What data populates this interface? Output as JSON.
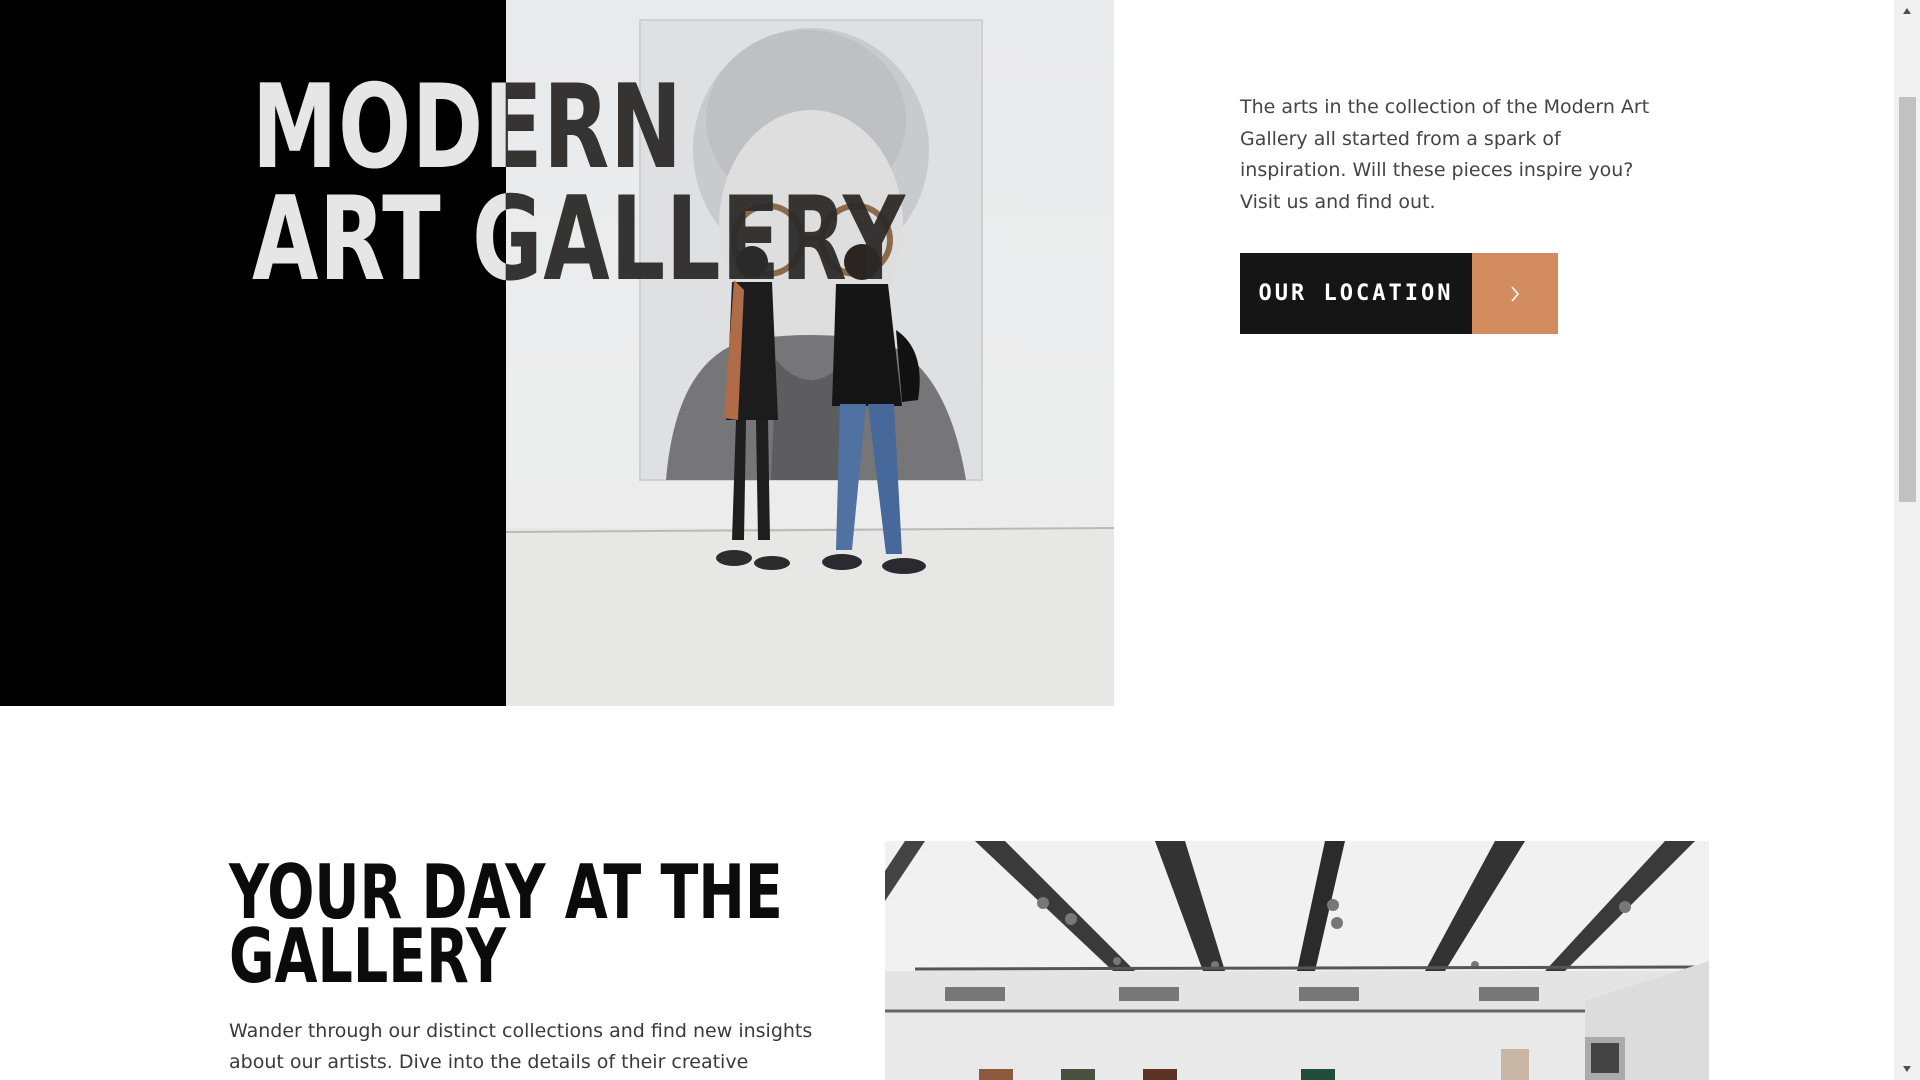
{
  "hero": {
    "title_line1": "MODERN",
    "title_line2": "ART GALLERY",
    "description": "The arts in the collection of the Modern Art Gallery all started from a spark of inspiration. Will these pieces inspire you? Visit us and find out.",
    "location_button": "OUR LOCATION",
    "arrow_icon": "chevron-right-icon"
  },
  "section": {
    "title_line1": "YOUR DAY AT THE",
    "title_line2": "GALLERY",
    "description": "Wander through our distinct collections and find new insights about our artists. Dive into the details of their creative process."
  },
  "colors": {
    "accent": "#d28c60",
    "button_dark": "#151515",
    "hero_black": "#000000"
  },
  "scrollbar": {
    "up_icon": "triangle-up-icon",
    "down_icon": "triangle-down-icon"
  }
}
